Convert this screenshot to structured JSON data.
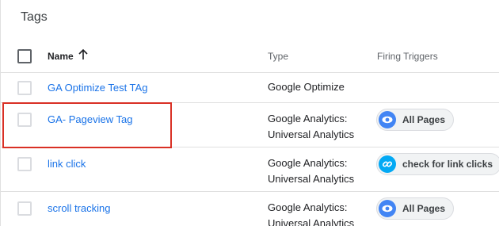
{
  "page": {
    "title": "Tags"
  },
  "table": {
    "columns": {
      "name": "Name",
      "type": "Type",
      "firing_triggers": "Firing Triggers"
    },
    "rows": [
      {
        "name": "GA Optimize Test TAg",
        "type_line1": "Google Optimize",
        "type_line2": "",
        "trigger": null
      },
      {
        "name": "GA- Pageview Tag",
        "type_line1": "Google Analytics:",
        "type_line2": "Universal Analytics",
        "trigger": {
          "label": "All Pages",
          "icon": "eye-icon",
          "color": "#4285f4"
        }
      },
      {
        "name": "link click",
        "type_line1": "Google Analytics:",
        "type_line2": "Universal Analytics",
        "trigger": {
          "label": "check for link clicks",
          "icon": "link-icon",
          "color": "#03a9f4"
        }
      },
      {
        "name": "scroll tracking",
        "type_line1": "Google Analytics:",
        "type_line2": "Universal Analytics",
        "trigger": {
          "label": "All Pages",
          "icon": "eye-icon",
          "color": "#4285f4"
        }
      }
    ]
  },
  "colors": {
    "link": "#1a73e8",
    "highlight": "#d93025",
    "eye_trigger": "#4285f4",
    "link_trigger": "#03a9f4"
  }
}
